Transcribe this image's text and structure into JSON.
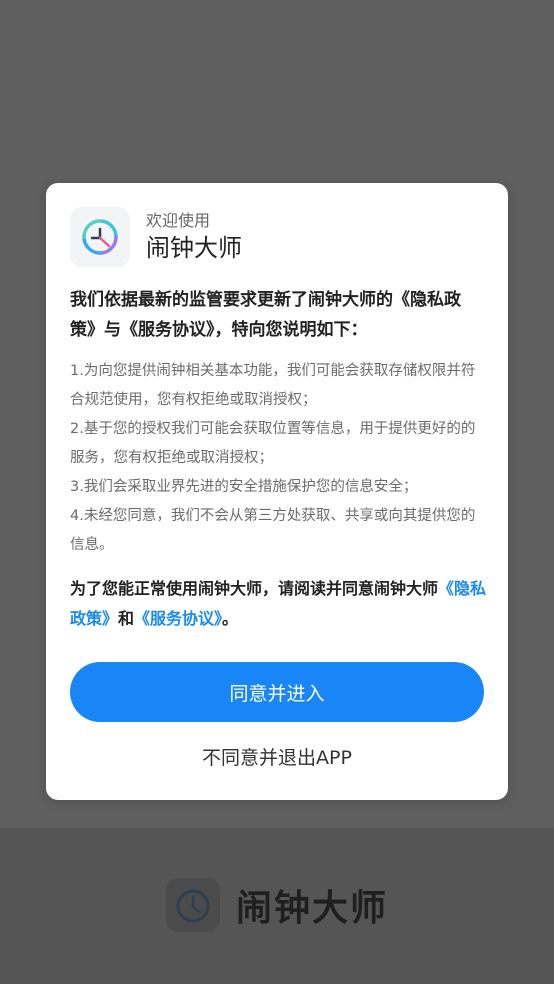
{
  "colors": {
    "accent": "#1986f7",
    "link": "#1a8bec",
    "backdrop": "#5f5f5f"
  },
  "dialog": {
    "welcome": "欢迎使用",
    "app_name": "闹钟大师",
    "logo_icon": "alarm-clock-icon",
    "intro": "我们依据最新的监管要求更新了闹钟大师的《隐私政策》与《服务协议》，特向您说明如下：",
    "items": [
      "1.为向您提供闹钟相关基本功能，我们可能会获取存储权限并符合规范使用，您有权拒绝或取消授权；",
      "2.基于您的授权我们可能会获取位置等信息，用于提供更好的的服务，您有权拒绝或取消授权；",
      "3.我们会采取业界先进的安全措施保护您的信息安全；",
      "4.未经您同意，我们不会从第三方处获取、共享或向其提供您的信息。"
    ],
    "agree_prefix": "为了您能正常使用闹钟大师，请阅读并同意闹钟大师",
    "privacy_link": "《隐私政策》",
    "and": "和",
    "service_link": "《服务协议》",
    "agree_suffix": "。",
    "agree_button": "同意并进入",
    "disagree_button": "不同意并退出APP"
  },
  "footer": {
    "title": "闹钟大师",
    "logo_icon": "alarm-clock-icon"
  }
}
